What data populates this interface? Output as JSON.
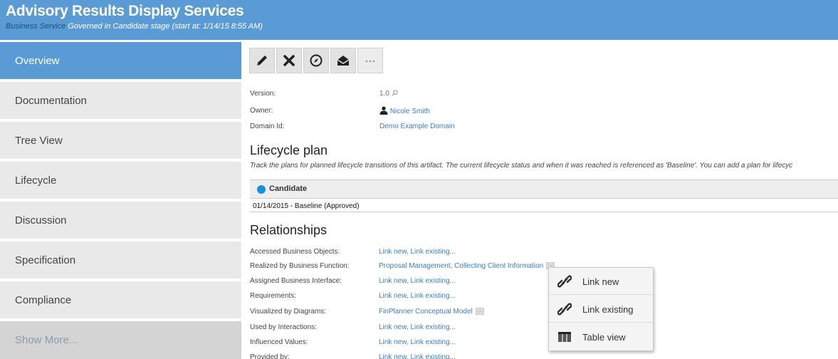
{
  "header": {
    "title": "Advisory Results Display Services",
    "type_label": "Business Service",
    "status_text": " Governed in Candidate stage (start at: 1/14/15 8:55 AM)"
  },
  "sidebar": {
    "items": [
      {
        "label": "Overview",
        "active": true
      },
      {
        "label": "Documentation"
      },
      {
        "label": "Tree View"
      },
      {
        "label": "Lifecycle"
      },
      {
        "label": "Discussion"
      },
      {
        "label": "Specification"
      },
      {
        "label": "Compliance"
      }
    ],
    "show_more": "Show More..."
  },
  "toolbar": {
    "buttons": [
      "pencil-icon",
      "x-icon",
      "compass-icon",
      "envelope-icon",
      "more-icon"
    ]
  },
  "properties": {
    "version_label": "Version:",
    "version_value": "1.0",
    "owner_label": "Owner:",
    "owner_value": "Nicole Smith",
    "domain_label": "Domain Id:",
    "domain_value": "Demo Example Domain"
  },
  "lifecycle": {
    "title": "Lifecycle plan",
    "description": "Track the plans for planned lifecycle transitions of this artifact. The current lifecycle status and when it was reached is referenced as 'Baseline'. You can add a plan for lifecyc",
    "stage": "Candidate",
    "stage_color": "#1a8fd8",
    "baseline": "01/14/2015 - Baseline (Approved)"
  },
  "relationships": {
    "title": "Relationships",
    "rows": [
      {
        "label": "Accessed Business Objects:",
        "value": "Link new, Link existing..."
      },
      {
        "label": "Realized by Business Function:",
        "value": "Proposal Management, Collecting Client Information"
      },
      {
        "label": "Assigned Business Interface:",
        "value": "Link new, Link existing..."
      },
      {
        "label": "Requirements:",
        "value": "Link new, Link existing..."
      },
      {
        "label": "Visualized by Diagrams:",
        "value": "FinPlanner Conceptual Model"
      },
      {
        "label": "Used by Interactions:",
        "value": "Link new, Link existing..."
      },
      {
        "label": "Influenced Values:",
        "value": "Link new, Link existing..."
      },
      {
        "label": "Provided by:",
        "value": "Link new, Link existing..."
      }
    ]
  },
  "popup": {
    "items": [
      {
        "label": "Link new",
        "icon": "link-icon"
      },
      {
        "label": "Link existing",
        "icon": "link-icon"
      },
      {
        "label": "Table view",
        "icon": "table-icon"
      }
    ]
  },
  "colors": {
    "header": "#5b9bd5",
    "sidebar_active": "#5b9bd5",
    "link": "#3a7fc1"
  }
}
